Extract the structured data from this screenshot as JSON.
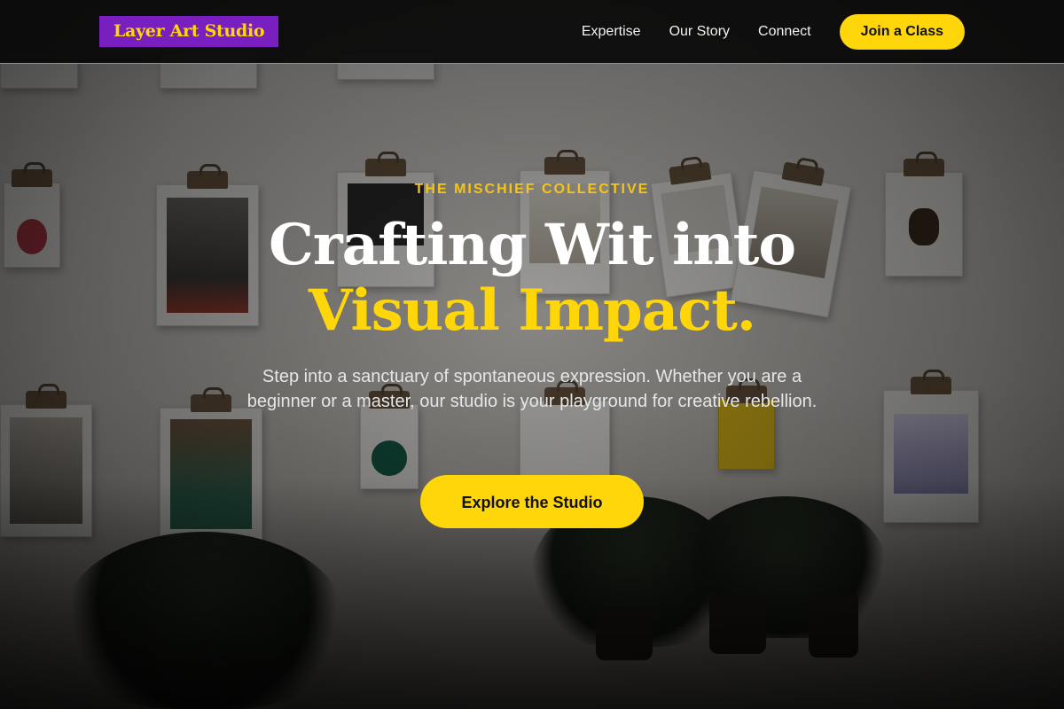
{
  "brand": {
    "logo_text": "Layer Art Studio",
    "logo_bg": "#7a1fbf",
    "logo_fg": "#ffd60a"
  },
  "nav": {
    "links": [
      "Expertise",
      "Our Story",
      "Connect"
    ],
    "cta_label": "Join a Class"
  },
  "hero": {
    "eyebrow": "THE MISCHIEF COLLECTIVE",
    "headline_line1": "Crafting Wit into",
    "headline_line2": "Visual Impact.",
    "lead": "Step into a sanctuary of spontaneous expression. Whether you are a beginner or a master, our studio is your playground for creative rebellion.",
    "cta_label": "Explore the Studio",
    "background_image": "wall-of-clipboards-photo"
  },
  "colors": {
    "accent": "#ffd60a",
    "header_bg": "#080808",
    "text_light": "#ffffff"
  }
}
